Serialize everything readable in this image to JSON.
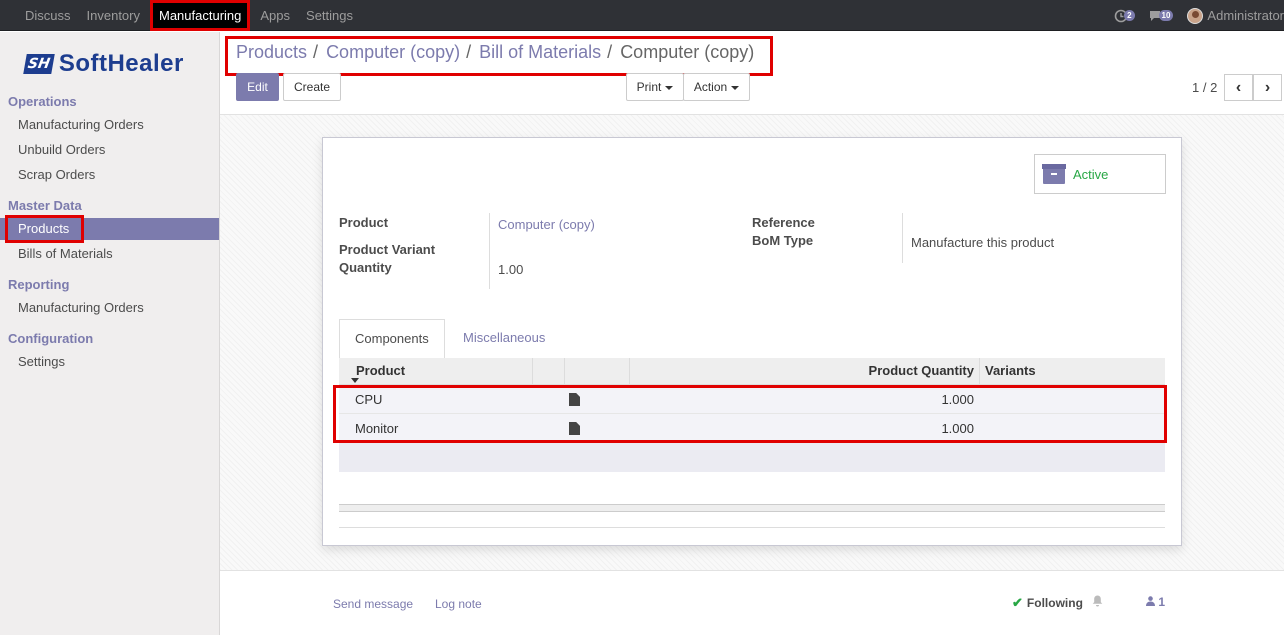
{
  "topbar": {
    "menu": [
      "Discuss",
      "Inventory",
      "Manufacturing",
      "Apps",
      "Settings"
    ],
    "active_menu": "Manufacturing",
    "activity_count": "2",
    "messages_count": "10",
    "user_name": "Administrator"
  },
  "logo": {
    "mark": "SH",
    "text": "SoftHealer"
  },
  "sidebar": {
    "operations": {
      "title": "Operations",
      "items": [
        "Manufacturing Orders",
        "Unbuild Orders",
        "Scrap Orders"
      ]
    },
    "master_data": {
      "title": "Master Data",
      "items": [
        "Products",
        "Bills of Materials"
      ],
      "active": "Products"
    },
    "reporting": {
      "title": "Reporting",
      "items": [
        "Manufacturing Orders"
      ]
    },
    "configuration": {
      "title": "Configuration",
      "items": [
        "Settings"
      ]
    }
  },
  "breadcrumb": [
    "Products",
    "Computer (copy)",
    "Bill of Materials",
    "Computer (copy)"
  ],
  "buttons": {
    "edit": "Edit",
    "create": "Create",
    "print": "Print",
    "action": "Action"
  },
  "pager": {
    "text": "1 / 2"
  },
  "form": {
    "status_button": "Active",
    "product_label": "Product",
    "product_value": "Computer (copy)",
    "variant_label": "Product Variant",
    "quantity_label": "Quantity",
    "quantity_value": "1.00",
    "reference_label": "Reference",
    "bom_type_label": "BoM Type",
    "bom_type_value": "Manufacture this product"
  },
  "tabs": [
    "Components",
    "Miscellaneous"
  ],
  "components_table": {
    "headers": {
      "product": "Product",
      "quantity": "Product Quantity",
      "variants": "Variants"
    },
    "rows": [
      {
        "product": "CPU",
        "quantity": "1.000"
      },
      {
        "product": "Monitor",
        "quantity": "1.000"
      }
    ]
  },
  "chatter": {
    "send_message": "Send message",
    "log_note": "Log note",
    "following": "Following",
    "followers": "1"
  }
}
